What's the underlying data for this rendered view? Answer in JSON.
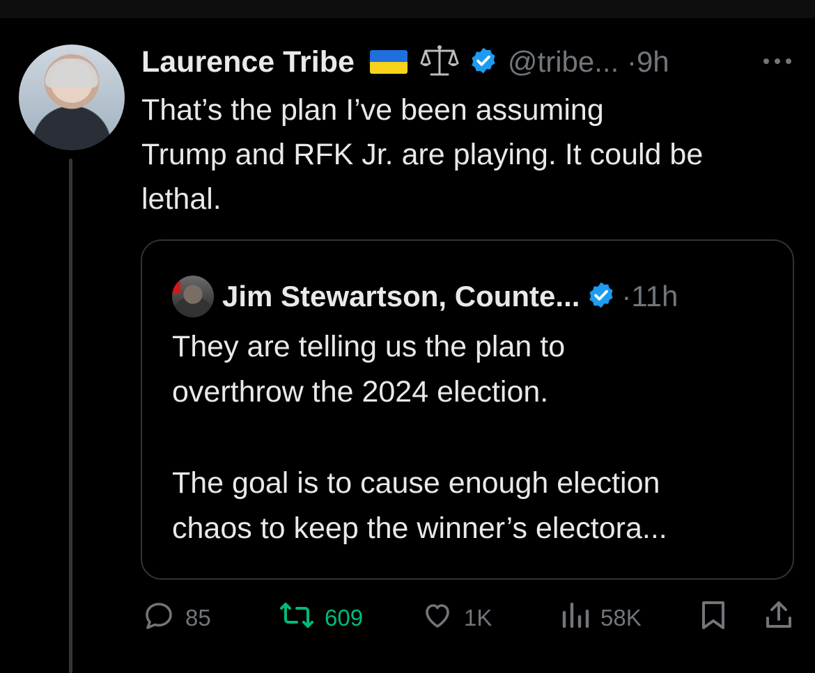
{
  "tweet": {
    "author_name": "Laurence Tribe",
    "handle": "@tribe...",
    "separator": "·",
    "time": "9h",
    "text_lines": [
      "That’s the plan I’ve been assuming",
      "Trump and RFK Jr. are playing. It could be",
      "lethal."
    ],
    "badges": [
      "ukraine-flag",
      "balance-scale-emoji",
      "verified-badge"
    ]
  },
  "quote": {
    "author_name": "Jim Stewartson, Counte...",
    "separator": "·",
    "time": "11h",
    "paragraph1_lines": [
      "They are telling us the plan to",
      "overthrow the 2024 election."
    ],
    "paragraph2_lines": [
      "The goal is to cause enough election",
      "chaos to keep the winner’s electora..."
    ]
  },
  "actions": {
    "replies": "85",
    "reposts": "609",
    "likes": "1K",
    "views": "58K"
  },
  "colors": {
    "background": "#000000",
    "text": "#e7e9ea",
    "muted": "#71767b",
    "verified": "#1d9bf0",
    "repost_active": "#00ba7c",
    "border": "#2f3336"
  }
}
